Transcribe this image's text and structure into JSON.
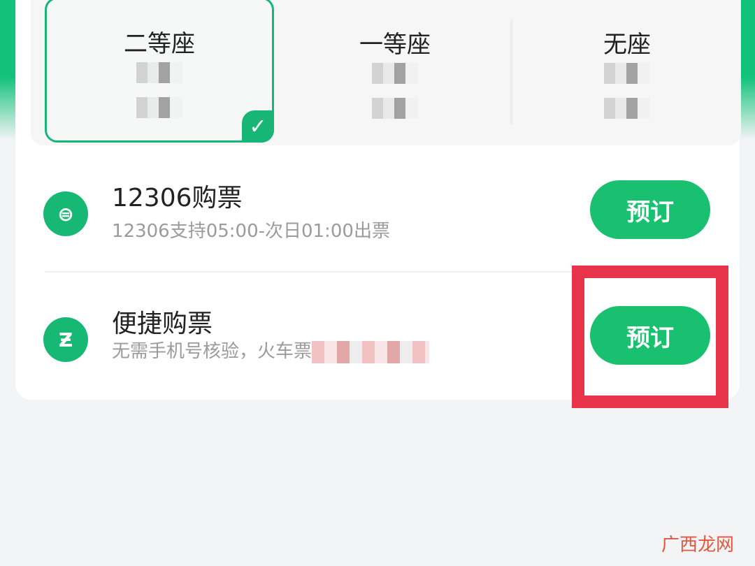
{
  "seats": [
    {
      "name": "二等座",
      "selected": true
    },
    {
      "name": "一等座",
      "selected": false
    },
    {
      "name": "无座",
      "selected": false
    }
  ],
  "options": [
    {
      "icon": "railway-logo-icon",
      "title": "12306购票",
      "subtitle": "12306支持05:00-次日01:00出票",
      "button": "预订"
    },
    {
      "icon": "express-ticket-icon",
      "title": "便捷购票",
      "subtitle": "无需手机号核验，火车票",
      "button": "预订"
    }
  ],
  "watermark": "广西龙网",
  "colors": {
    "accent": "#18c06f",
    "highlight": "#e8344a"
  }
}
